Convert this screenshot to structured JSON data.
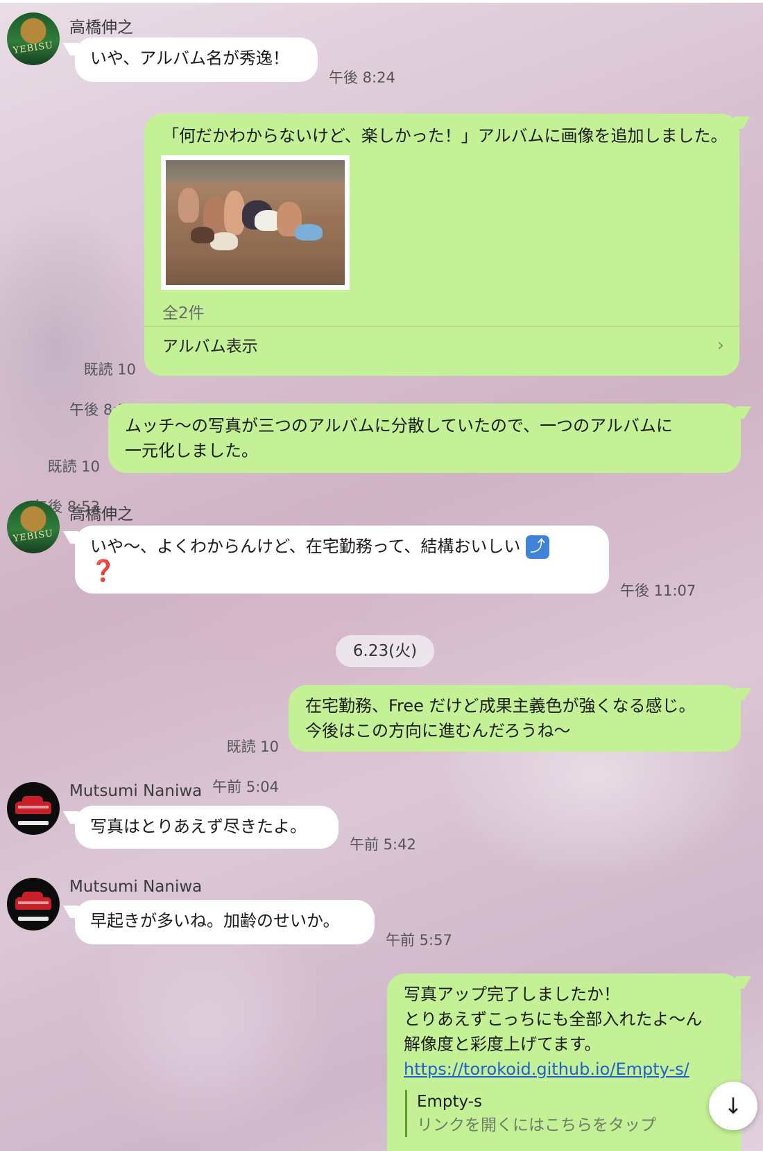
{
  "colors": {
    "incoming_bubble": "#ffffff",
    "outgoing_bubble": "#c4f096",
    "link": "#2060d0"
  },
  "messages": [
    {
      "sender": "高橋伸之",
      "text": "いや、アルバム名が秀逸！",
      "time": "午後 8:24"
    },
    {
      "text": "「何だかわからないけど、楽しかった！」アルバムに画像を追加しました。",
      "album_count": "全2件",
      "album_link": "アルバム表示",
      "read": "既読 10",
      "time": "午後 8:52"
    },
    {
      "text": "ムッチ〜の写真が三つのアルバムに分散していたので、一つのアルバムに\n一元化しました。",
      "read": "既読 10",
      "time": "午後 8:53"
    },
    {
      "sender": "高橋伸之",
      "text": "いや〜、よくわからんけど、在宅勤務って、結構おいしい",
      "emoji_1": "⤴",
      "emoji_2": "❓",
      "time": "午後 11:07"
    },
    {
      "text": "在宅勤務、Free だけど成果主義色が強くなる感じ。\n今後はこの方向に進むんだろうね〜",
      "read": "既読 10",
      "time": "午前 5:04"
    },
    {
      "sender": "Mutsumi Naniwa",
      "text": "写真はとりあえず尽きたよ。",
      "time": "午前 5:42"
    },
    {
      "sender": "Mutsumi Naniwa",
      "text": "早起きが多いね。加齢のせいか。",
      "time": "午前 5:57"
    },
    {
      "text": "写真アップ完了しましたか！\nとりあえずこっちにも全部入れたよ〜ん\n解像度と彩度上げてます。",
      "link": "https://torokoid.github.io/Empty-s/",
      "preview_title": "Empty-s",
      "preview_desc": "リンクを開くにはこちらをタップ"
    }
  ],
  "date_separator": "6.23(火)",
  "avatars": {
    "yebisu_logo": "YEBISU"
  },
  "icons": {
    "chevron": "›",
    "scroll_down": "↓"
  }
}
